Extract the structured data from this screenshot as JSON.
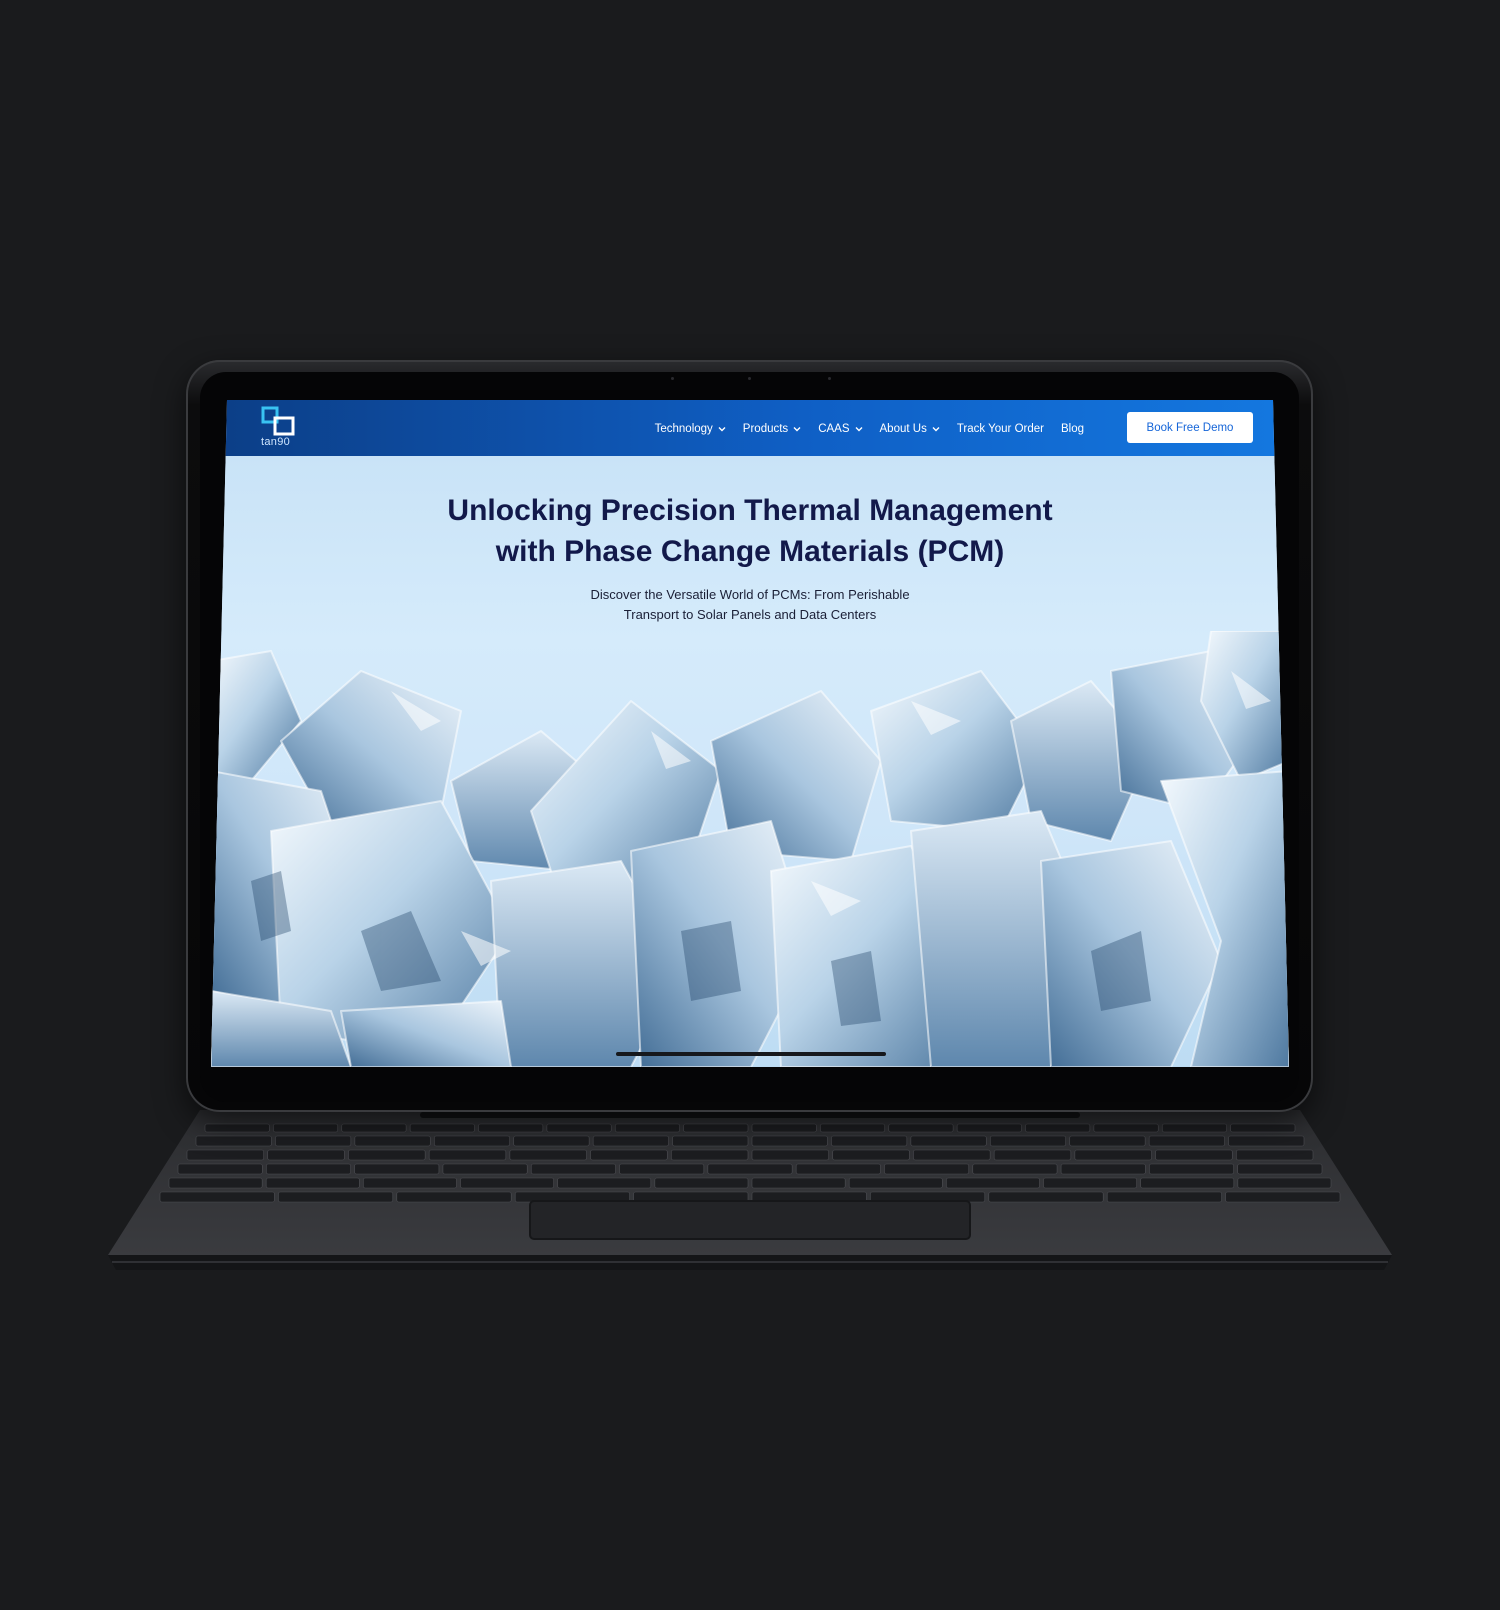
{
  "brand": {
    "logo_text": "tan90"
  },
  "nav": {
    "items": [
      {
        "label": "Technology",
        "dropdown": true
      },
      {
        "label": "Products",
        "dropdown": true
      },
      {
        "label": "CAAS",
        "dropdown": true
      },
      {
        "label": "About Us",
        "dropdown": true
      },
      {
        "label": "Track Your Order",
        "dropdown": false
      },
      {
        "label": "Blog",
        "dropdown": false
      }
    ],
    "cta_label": "Book Free Demo"
  },
  "hero": {
    "title_line1": "Unlocking Precision Thermal Management",
    "title_line2": "with Phase Change Materials (PCM)",
    "subtitle_line1": "Discover the Versatile World of PCMs: From Perishable",
    "subtitle_line2": "Transport to Solar Panels and Data Centers"
  },
  "colors": {
    "page_background": "#1a1b1d",
    "navbar_start": "#0c3e86",
    "navbar_end": "#1478e0",
    "cta_text": "#1565d8",
    "title_text": "#12194a",
    "hero_background": "#d5ebfb",
    "logo_accent": "#39c3f2"
  },
  "icons": [
    "tan90-logo-icon",
    "chevron-down-icon"
  ]
}
